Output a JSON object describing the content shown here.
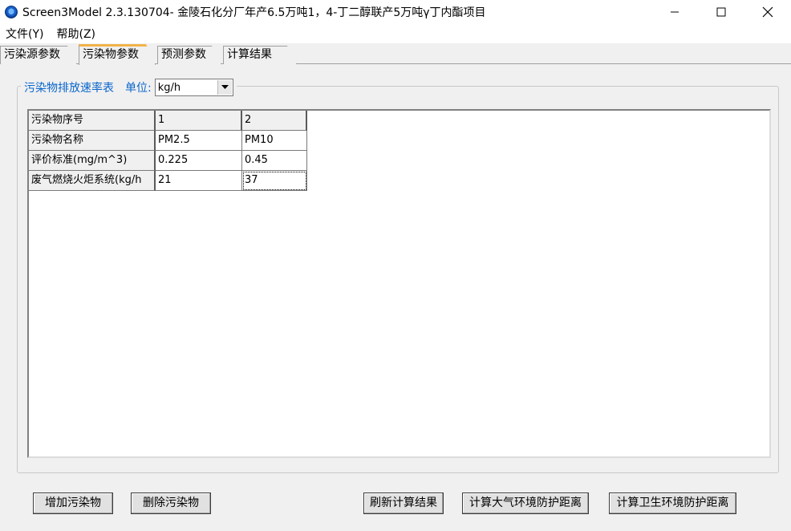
{
  "window": {
    "title": "Screen3Model 2.3.130704- 金陵石化分厂年产6.5万吨1，4-丁二醇联产5万吨γ丁内酯项目"
  },
  "menu": {
    "items": [
      "文件(Y)",
      "帮助(Z)"
    ]
  },
  "tabs": [
    {
      "label": "污染源参数",
      "active": false
    },
    {
      "label": "污染物参数",
      "active": true
    },
    {
      "label": "预测参数",
      "active": false
    },
    {
      "label": "计算结果",
      "active": false
    }
  ],
  "group": {
    "title": "污染物排放速率表",
    "unit_label": "单位:",
    "unit_value": "kg/h"
  },
  "table": {
    "rows": [
      {
        "label": "污染物序号",
        "values": [
          "1",
          "2"
        ]
      },
      {
        "label": "污染物名称",
        "values": [
          "PM2.5",
          "PM10"
        ]
      },
      {
        "label": "评价标准(mg/m^3)",
        "values": [
          "0.225",
          "0.45"
        ]
      },
      {
        "label": "废气燃烧火炬系统(kg/h",
        "values": [
          "21",
          "37"
        ]
      }
    ]
  },
  "buttons": {
    "add": "增加污染物",
    "delete": "删除污染物",
    "refresh": "刷新计算结果",
    "atmos": "计算大气环境防护距离",
    "health": "计算卫生环境防护距离"
  },
  "colors": {
    "accent_tab": "#f3b34a",
    "group_title": "#0a66cc"
  }
}
